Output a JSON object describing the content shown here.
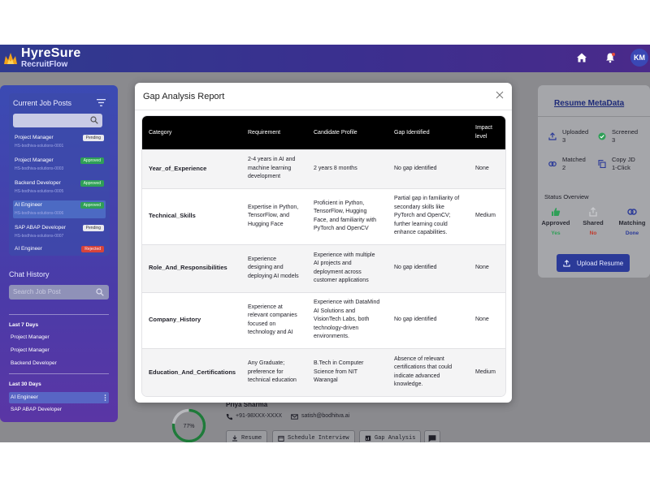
{
  "header": {
    "brand_title": "HyreSure",
    "brand_subtitle": "RecruitFlow",
    "avatar_initials": "KM",
    "icons": [
      "home-icon",
      "bell-icon"
    ]
  },
  "sidebar": {
    "jobs_title": "Current Job Posts",
    "jobs": [
      {
        "title": "Project Manager",
        "sub": "HS-bodhiva-solutions-0001",
        "status": "Pending",
        "kind": "pending"
      },
      {
        "title": "Project Manager",
        "sub": "HS-bodhiva-solutions-0003",
        "status": "Approved",
        "kind": "approved"
      },
      {
        "title": "Backend Developer",
        "sub": "HS-bodhiva-solutions-0005",
        "status": "Approved",
        "kind": "approved"
      },
      {
        "title": "AI Engineer",
        "sub": "HS-bodhiva-solutions-0006",
        "status": "Approved",
        "kind": "approved"
      },
      {
        "title": "SAP ABAP Developer",
        "sub": "HS-bodhiva-solutions-0007",
        "status": "Pending",
        "kind": "pending"
      },
      {
        "title": "AI Engineer",
        "sub": "",
        "status": "Rejected",
        "kind": "rejected"
      }
    ],
    "chat_title": "Chat History",
    "chat_search_placeholder": "Search Job Post",
    "last7_label": "Last 7 Days",
    "last7_items": [
      "Project Manager",
      "Project Manager",
      "Backend Developer"
    ],
    "last30_label": "Last 30 Days",
    "last30_items": [
      "AI Engineer",
      "SAP ABAP Developer"
    ]
  },
  "resume_meta": {
    "title": "Resume MetaData",
    "uploaded_label": "Uploaded",
    "uploaded_value": "3",
    "screened_label": "Screened",
    "screened_value": "3",
    "matched_label": "Matched",
    "matched_value": "2",
    "copy_label": "Copy JD",
    "copy_sub": "1-Click",
    "overview_label": "Status Overview",
    "overview": [
      {
        "label": "Approved",
        "status": "Yes",
        "color": "#2f9f57"
      },
      {
        "label": "Shared",
        "status": "No",
        "color": "#c0392b"
      },
      {
        "label": "Matching",
        "status": "Done",
        "color": "#2b3a98"
      }
    ],
    "upload_label": "Upload Resume"
  },
  "candidate": {
    "name": "Priya Sharma",
    "phone": "+91-98XXX-XXXX",
    "email": "satish@bodhitva.ai",
    "score_percent": 77,
    "score_text": "77%",
    "actions": [
      "Resume",
      "Schedule Interview",
      "Gap Analysis"
    ]
  },
  "modal": {
    "title": "Gap Analysis Report",
    "columns": [
      "Category",
      "Requirement",
      "Candidate Profile",
      "Gap Identified",
      "Impact level"
    ],
    "rows": [
      {
        "category": "Year_of_Experience",
        "requirement": "2-4 years in AI and machine learning development",
        "profile": "2 years 8 months",
        "gap": "No gap identified",
        "impact": "None"
      },
      {
        "category": "Technical_Skills",
        "requirement": "Expertise in Python, TensorFlow, and Hugging Face",
        "profile": "Proficient in Python, TensorFlow, Hugging Face, and familiarity with PyTorch and OpenCV",
        "gap": "Partial gap in familiarity of secondary skills like PyTorch and OpenCV; further learning could enhance capabilities.",
        "impact": "Medium"
      },
      {
        "category": "Role_And_Responsibilities",
        "requirement": "Experience designing and deploying AI models",
        "profile": "Experience with multiple AI projects and deployment across customer applications",
        "gap": "No gap identified",
        "impact": "None"
      },
      {
        "category": "Company_History",
        "requirement": "Experience at relevant companies focused on technology and AI",
        "profile": "Experience with DataMind AI Solutions and VisionTech Labs, both technology-driven environments.",
        "gap": "No gap identified",
        "impact": "None"
      },
      {
        "category": "Education_And_Certifications",
        "requirement": "Any Graduate; preference for technical education",
        "profile": "B.Tech in Computer Science from NIT Warangal",
        "gap": "Absence of relevant certifications that could indicate advanced knowledge.",
        "impact": "Medium"
      }
    ]
  }
}
